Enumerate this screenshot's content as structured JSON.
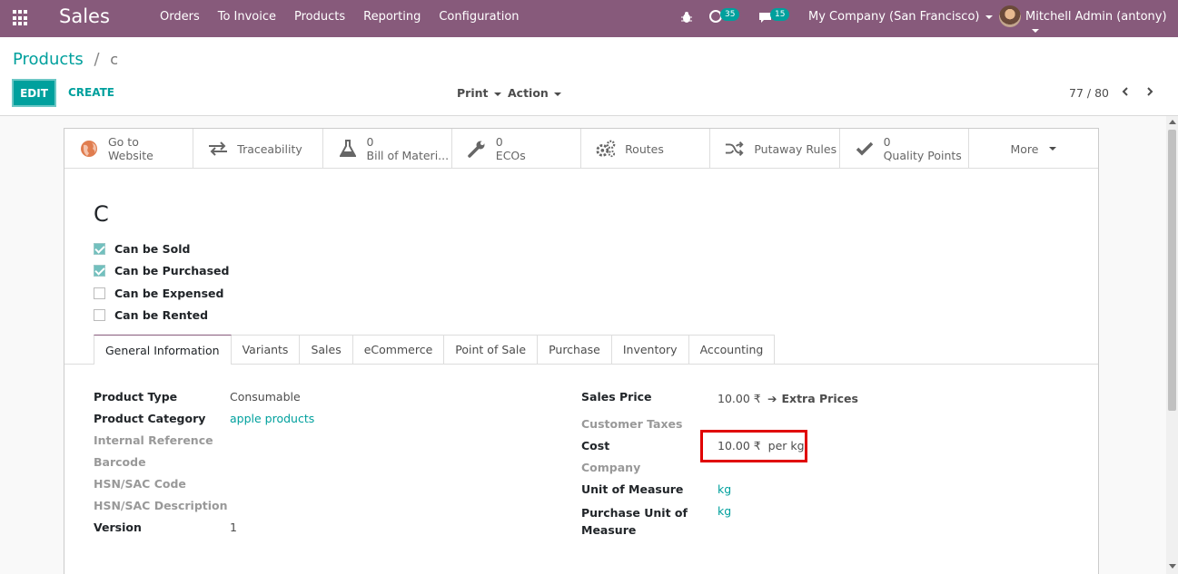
{
  "navbar": {
    "app_name": "Sales",
    "menu": [
      "Orders",
      "To Invoice",
      "Products",
      "Reporting",
      "Configuration"
    ],
    "activity_count": "35",
    "message_count": "15",
    "company": "My Company (San Francisco)",
    "user": "Mitchell Admin (antony)"
  },
  "control_panel": {
    "breadcrumb_parent": "Products",
    "breadcrumb_separator": "/",
    "breadcrumb_current": "c",
    "edit_label": "EDIT",
    "create_label": "CREATE",
    "print_label": "Print",
    "action_label": "Action",
    "pager": "77 / 80"
  },
  "smart_buttons": [
    {
      "icon": "globe-icon",
      "label": "Go to Website",
      "line1": "Go to",
      "line2": "Website"
    },
    {
      "icon": "exchange-icon",
      "label": "Traceability"
    },
    {
      "icon": "flask-icon",
      "line1": "0",
      "line2": "Bill of Materi..."
    },
    {
      "icon": "wrench-icon",
      "line1": "0",
      "line2": "ECOs"
    },
    {
      "icon": "cogs-icon",
      "label": "Routes"
    },
    {
      "icon": "random-icon",
      "label": "Putaway Rules"
    },
    {
      "icon": "check-icon",
      "line1": "0",
      "line2": "Quality Points"
    },
    {
      "label": "More"
    }
  ],
  "product": {
    "name": "C",
    "options": [
      {
        "label": "Can be Sold",
        "checked": true
      },
      {
        "label": "Can be Purchased",
        "checked": true
      },
      {
        "label": "Can be Expensed",
        "checked": false
      },
      {
        "label": "Can be Rented",
        "checked": false
      }
    ]
  },
  "tabs": [
    "General Information",
    "Variants",
    "Sales",
    "eCommerce",
    "Point of Sale",
    "Purchase",
    "Inventory",
    "Accounting"
  ],
  "left_fields": [
    {
      "label": "Product Type",
      "value": "Consumable"
    },
    {
      "label": "Product Category",
      "value": "apple products"
    },
    {
      "label": "Internal Reference",
      "value": ""
    },
    {
      "label": "Barcode",
      "value": ""
    },
    {
      "label": "HSN/SAC Code",
      "value": ""
    },
    {
      "label": "HSN/SAC Description",
      "value": ""
    },
    {
      "label": "Version",
      "value": "1"
    }
  ],
  "right_fields": [
    {
      "label": "Sales Price",
      "value": "10.00 ₹",
      "extra": "Extra Prices"
    },
    {
      "label": "Customer Taxes",
      "value": ""
    },
    {
      "label": "Cost",
      "value": "10.00 ₹  per kg"
    },
    {
      "label": "Company",
      "value": ""
    },
    {
      "label": "Unit of Measure",
      "value": "kg"
    },
    {
      "label": "Purchase Unit of Measure",
      "line1": "Purchase Unit of",
      "line2": "Measure",
      "value": "kg"
    }
  ],
  "colors": {
    "brand": "#875a7b",
    "accent": "#00a09d",
    "highlight": "#e00000"
  }
}
